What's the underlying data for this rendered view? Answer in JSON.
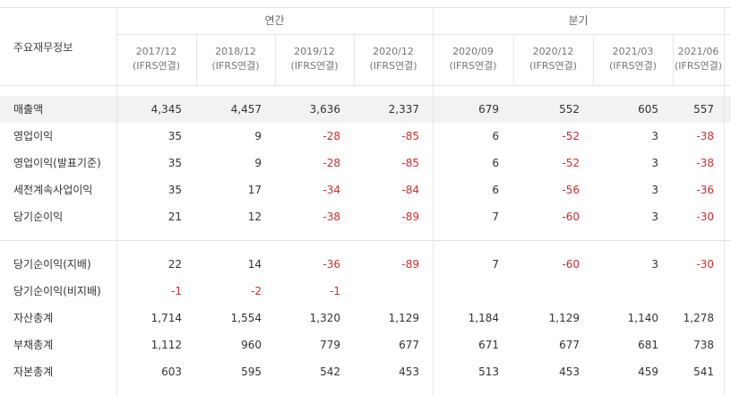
{
  "table": {
    "corner_label": "주요재무정보",
    "group_annual": "연간",
    "group_quarter": "분기",
    "periods": [
      {
        "date": "2017/12",
        "basis": "(IFRS연결)"
      },
      {
        "date": "2018/12",
        "basis": "(IFRS연결)"
      },
      {
        "date": "2019/12",
        "basis": "(IFRS연결)"
      },
      {
        "date": "2020/12",
        "basis": "(IFRS연결)"
      },
      {
        "date": "2020/09",
        "basis": "(IFRS연결)"
      },
      {
        "date": "2020/12",
        "basis": "(IFRS연결)"
      },
      {
        "date": "2021/03",
        "basis": "(IFRS연결)"
      },
      {
        "date": "2021/06",
        "basis": "(IFRS연결)"
      }
    ],
    "rows": [
      {
        "label": "매출액",
        "values": [
          "4,345",
          "4,457",
          "3,636",
          "2,337",
          "679",
          "552",
          "605",
          "557"
        ]
      },
      {
        "label": "영업이익",
        "values": [
          "35",
          "9",
          "-28",
          "-85",
          "6",
          "-52",
          "3",
          "-38"
        ]
      },
      {
        "label": "영업이익(발표기준)",
        "values": [
          "35",
          "9",
          "-28",
          "-85",
          "6",
          "-52",
          "3",
          "-38"
        ]
      },
      {
        "label": "세전계속사업이익",
        "values": [
          "35",
          "17",
          "-34",
          "-84",
          "6",
          "-56",
          "3",
          "-36"
        ]
      },
      {
        "label": "당기순이익",
        "values": [
          "21",
          "12",
          "-38",
          "-89",
          "7",
          "-60",
          "3",
          "-30"
        ]
      },
      {
        "label": "당기순이익(지배)",
        "values": [
          "22",
          "14",
          "-36",
          "-89",
          "7",
          "-60",
          "3",
          "-30"
        ]
      },
      {
        "label": "당기순이익(비지배)",
        "values": [
          "-1",
          "-2",
          "-1",
          "",
          "",
          "",
          "",
          ""
        ]
      },
      {
        "label": "자산총계",
        "values": [
          "1,714",
          "1,554",
          "1,320",
          "1,129",
          "1,184",
          "1,129",
          "1,140",
          "1,278"
        ]
      },
      {
        "label": "부채총계",
        "values": [
          "1,112",
          "960",
          "779",
          "677",
          "671",
          "677",
          "681",
          "738"
        ]
      },
      {
        "label": "자본총계",
        "values": [
          "603",
          "595",
          "542",
          "453",
          "513",
          "453",
          "459",
          "541"
        ]
      }
    ],
    "colors": {
      "negative": "#d62b2b",
      "highlight_row": "#f2f2f2"
    }
  }
}
